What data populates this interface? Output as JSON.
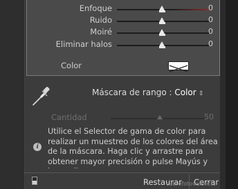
{
  "sliders": [
    {
      "label": "Enfoque",
      "value": "0",
      "level": 0.5
    },
    {
      "label": "Ruido",
      "value": "0",
      "level": 0.5
    },
    {
      "label": "Moiré",
      "value": "0",
      "level": 0.5
    },
    {
      "label": "Eliminar halos",
      "value": "0",
      "level": 0.5
    }
  ],
  "color": {
    "label": "Color",
    "swatch_color": "#ffffff"
  },
  "range_mask": {
    "label": "Máscara de rango : ",
    "value": "Color",
    "arrows": "⇕"
  },
  "amount": {
    "label": "Cantidad",
    "value": "50",
    "level": 0.5
  },
  "help": {
    "text": "Utilice el Selector de gama de color para realizar un muestreo de los colores del área de la máscara. Haga clic y arrastre para obtener mayor precisión o pulse Mayús y haga clic para"
  },
  "footer": {
    "restore_label": "Restaurar",
    "close_label": "Cerrar",
    "watermark": "cubrefotovalencia"
  }
}
